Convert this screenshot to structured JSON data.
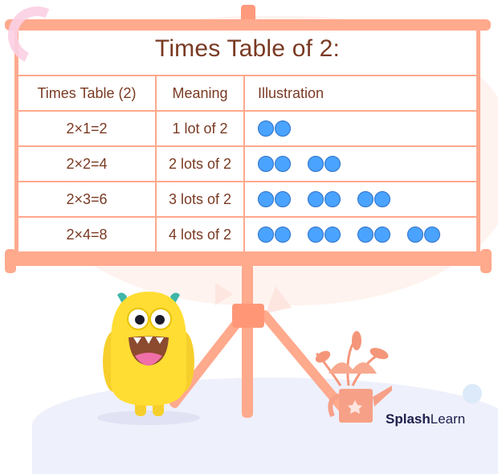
{
  "title": "Times Table of 2:",
  "table": {
    "headers": [
      "Times Table (2)",
      "Meaning",
      "Illustration"
    ],
    "rows": [
      {
        "equation": "2×1=2",
        "meaning": "1 lot of 2",
        "groups": 1
      },
      {
        "equation": "2×2=4",
        "meaning": "2 lots of 2",
        "groups": 2
      },
      {
        "equation": "2×3=6",
        "meaning": "3 lots of 2",
        "groups": 3
      },
      {
        "equation": "2×4=8",
        "meaning": "4 lots of 2",
        "groups": 4
      }
    ],
    "items_per_group": 2
  },
  "brand": {
    "bold": "Splash",
    "regular": "Learn"
  },
  "colors": {
    "board_frame": "#ffa98d",
    "text": "#7a3a23",
    "dot_fill": "#4aa3ff",
    "dot_stroke": "#2c6fc7",
    "brand_text": "#1c1f4b"
  }
}
